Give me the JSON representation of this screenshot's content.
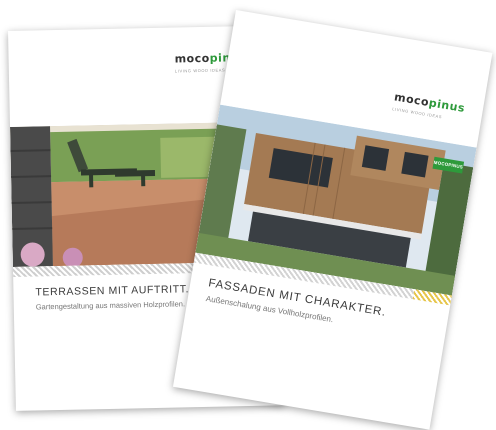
{
  "brochures": [
    {
      "logo_main": "moco",
      "logo_accent": "pinus",
      "logo_tagline": "LIVING WOOD IDEAS",
      "headline": "TERRASSEN MIT AUFTRITT.",
      "subline": "Gartengestaltung aus massiven Holzprofilen."
    },
    {
      "logo_main": "moco",
      "logo_accent": "pinus",
      "logo_tagline": "LIVING WOOD IDEAS",
      "badge": "MOCOPINUS",
      "headline": "FASSADEN MIT CHARAKTER.",
      "subline": "Außenschalung aus Vollholzprofilen."
    }
  ],
  "colors": {
    "brand_green": "#2e9a3b",
    "accent_yellow": "#e7c64a"
  }
}
